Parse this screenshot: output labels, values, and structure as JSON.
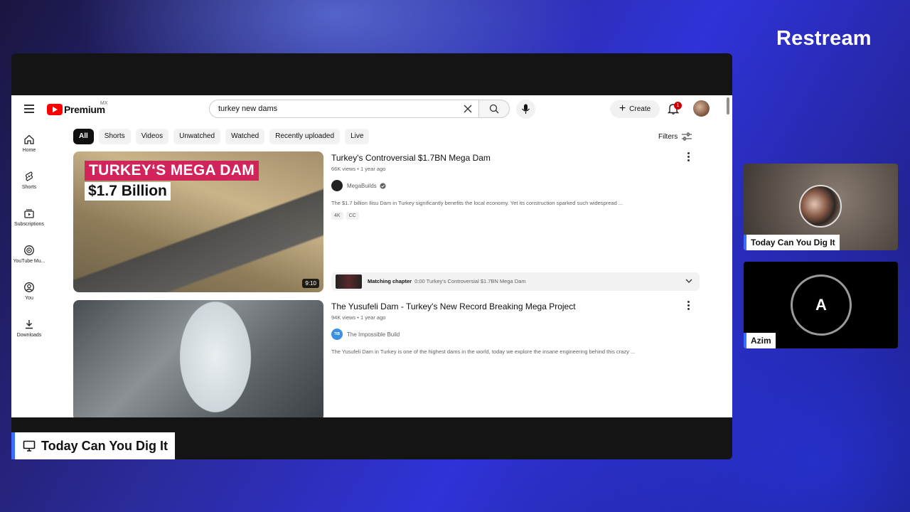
{
  "brand": "Restream",
  "stage": {
    "source_label": "Today Can You Dig It"
  },
  "youtube": {
    "logo_text": "Premium",
    "country": "MX",
    "search_value": "turkey new dams",
    "create_label": "Create",
    "notification_count": "1",
    "sidebar": [
      {
        "label": "Home",
        "icon": "home-icon"
      },
      {
        "label": "Shorts",
        "icon": "shorts-icon"
      },
      {
        "label": "Subscriptions",
        "icon": "subscriptions-icon"
      },
      {
        "label": "YouTube Mu...",
        "icon": "youtube-music-icon"
      },
      {
        "label": "You",
        "icon": "you-icon"
      },
      {
        "label": "Downloads",
        "icon": "download-icon"
      }
    ],
    "chips": [
      "All",
      "Shorts",
      "Videos",
      "Unwatched",
      "Watched",
      "Recently uploaded",
      "Live"
    ],
    "filters_label": "Filters",
    "results": [
      {
        "title": "Turkey's Controversial $1.7BN Mega Dam",
        "meta": "66K views • 1 year ago",
        "channel": "MegaBuilds",
        "verified": true,
        "description": "The $1.7 billion Ilisu Dam in Turkey significantly benefits the local economy. Yet its construction sparked such widespread ...",
        "badges": [
          "4K",
          "CC"
        ],
        "thumb_text_1": "TURKEY‘S MEGA DAM",
        "thumb_text_2": "$1.7 Billion",
        "duration": "9:10",
        "chapter_label": "Matching chapter",
        "chapter_text": "0:00 Turkey's Controversial $1.7BN Mega Dam"
      },
      {
        "title": "The Yusufeli Dam - Turkey's New Record Breaking Mega Project",
        "meta": "94K views • 1 year ago",
        "channel": "The Impossible Build",
        "channel_avatar_text": "TIB",
        "description": "The Yusufeli Dam in Turkey is one of the highest dams in the world, today we explore the insane engineering behind this crazy ..."
      }
    ]
  },
  "participants": [
    {
      "name": "Today Can You Dig It"
    },
    {
      "name": "Azim",
      "initial": "A"
    }
  ],
  "colors": {
    "accent": "#3b6cff",
    "youtube_red": "#ff0000",
    "thumb_tag": "#d0245a"
  }
}
